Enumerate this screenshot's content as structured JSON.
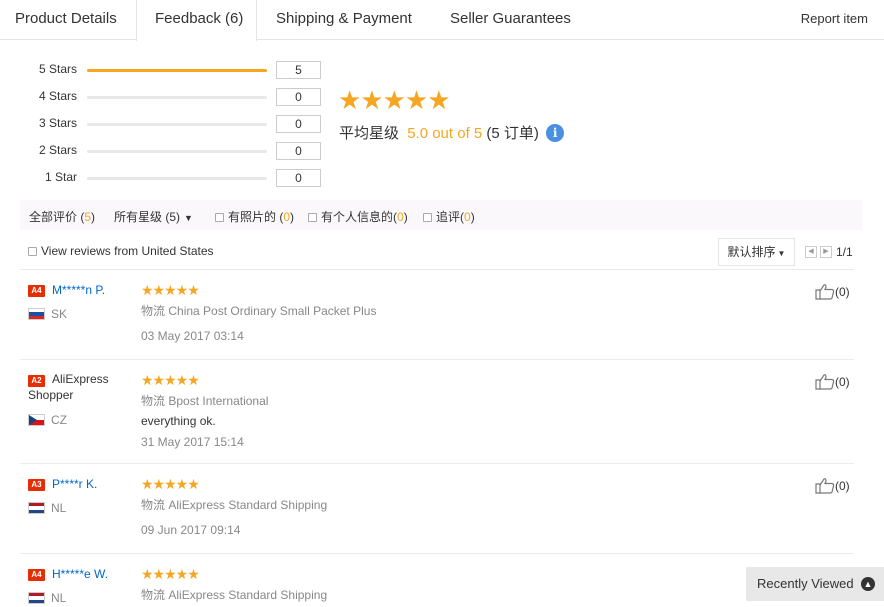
{
  "tabs": [
    {
      "label": "Product Details"
    },
    {
      "label": "Feedback (6)"
    },
    {
      "label": "Shipping & Payment"
    },
    {
      "label": "Seller Guarantees"
    }
  ],
  "report_label": "Report item",
  "histogram": [
    {
      "label": "5 Stars",
      "count": "5",
      "fraction": 1.0
    },
    {
      "label": "4 Stars",
      "count": "0",
      "fraction": 0
    },
    {
      "label": "3 Stars",
      "count": "0",
      "fraction": 0
    },
    {
      "label": "2 Stars",
      "count": "0",
      "fraction": 0
    },
    {
      "label": "1 Star",
      "count": "0",
      "fraction": 0
    }
  ],
  "average": {
    "stars": "★★★★★",
    "label": "平均星级",
    "score_text": "5.0 out of 5",
    "orders_text": "(5 订单)",
    "info": "i"
  },
  "filters": {
    "all_label": "全部评价 (",
    "all_count": "5",
    "all_close": ")",
    "stars_select": "所有星级 (5)",
    "photos_label": "有照片的 (",
    "photos_count": "0",
    "personal_label": "有个人信息的(",
    "personal_count": "0",
    "followup_label": "追评(",
    "followup_count": "0",
    "close": ")"
  },
  "view_us_label": "View reviews from United States",
  "sort_label": "默认排序",
  "pagination": "1/1",
  "shipping_label": "物流",
  "reviews": [
    {
      "badge": "A4",
      "name": "M*****n P.",
      "country": "SK",
      "stars": "★★★★★",
      "shipping": "China Post Ordinary Small Packet Plus",
      "text": "",
      "date": "03 May 2017 03:14",
      "likes": "(0)"
    },
    {
      "badge": "A2",
      "name": "AliExpress Shopper",
      "country": "CZ",
      "stars": "★★★★★",
      "shipping": "Bpost International",
      "text": "everything ok.",
      "date": "31 May 2017 15:14",
      "likes": "(0)"
    },
    {
      "badge": "A3",
      "name": "P****r K.",
      "country": "NL",
      "stars": "★★★★★",
      "shipping": "AliExpress Standard Shipping",
      "text": "",
      "date": "09 Jun 2017 09:14",
      "likes": "(0)"
    },
    {
      "badge": "A4",
      "name": "H*****e W.",
      "country": "NL",
      "stars": "★★★★★",
      "shipping": "AliExpress Standard Shipping",
      "text": "",
      "date": "",
      "likes": ""
    }
  ],
  "recently_viewed": "Recently Viewed",
  "colors": {
    "accent": "#f5a623",
    "badge": "#e62e04",
    "link": "#0066cc",
    "info": "#4a90e2"
  }
}
